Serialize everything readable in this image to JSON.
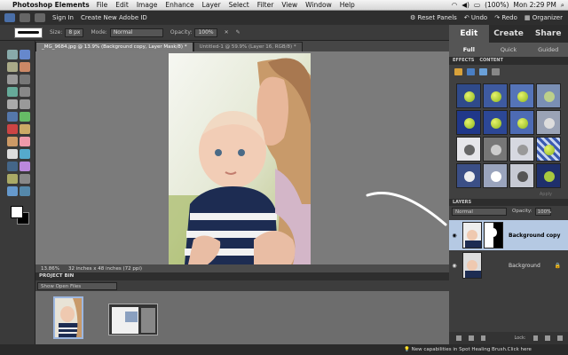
{
  "menubar": {
    "app_name": "Photoshop Elements",
    "items": [
      "File",
      "Edit",
      "Image",
      "Enhance",
      "Layer",
      "Select",
      "Filter",
      "View",
      "Window",
      "Help"
    ],
    "battery": "(100%)",
    "clock": "Mon 2:29 PM"
  },
  "topbar": {
    "sign_in": "Sign In",
    "create_id": "Create New Adobe ID",
    "reset_panels": "Reset Panels",
    "undo": "Undo",
    "redo": "Redo",
    "organizer": "Organizer"
  },
  "options": {
    "size_label": "Size:",
    "size_value": "8 px",
    "mode_label": "Mode:",
    "mode_value": "Normal",
    "opacity_label": "Opacity:",
    "opacity_value": "100%"
  },
  "mode_tabs": {
    "tabs": [
      "Edit",
      "Create",
      "Share"
    ],
    "sub": [
      "Full",
      "Quick",
      "Guided"
    ]
  },
  "doc_tabs": [
    "_MG_9684.jpg @ 13.9% (Background copy, Layer Mask/8) *",
    "Untitled-1 @ 59.9% (Layer 16, RGB/8) *"
  ],
  "status": {
    "zoom": "13.86%",
    "size": "32 inches x 48 inches (72 ppi)"
  },
  "project_bin": {
    "title": "PROJECT BIN",
    "filter": "Show Open Files"
  },
  "effects": {
    "tabs": [
      "EFFECTS",
      "CONTENT"
    ],
    "apply": "Apply"
  },
  "layers": {
    "title": "LAYERS",
    "blend": "Normal",
    "opacity_label": "Opacity:",
    "opacity_value": "100%",
    "items": [
      {
        "name": "Background copy"
      },
      {
        "name": "Background"
      }
    ],
    "lock_label": "Lock:"
  },
  "tip": "New capabilities in Spot Healing Brush.Click here"
}
